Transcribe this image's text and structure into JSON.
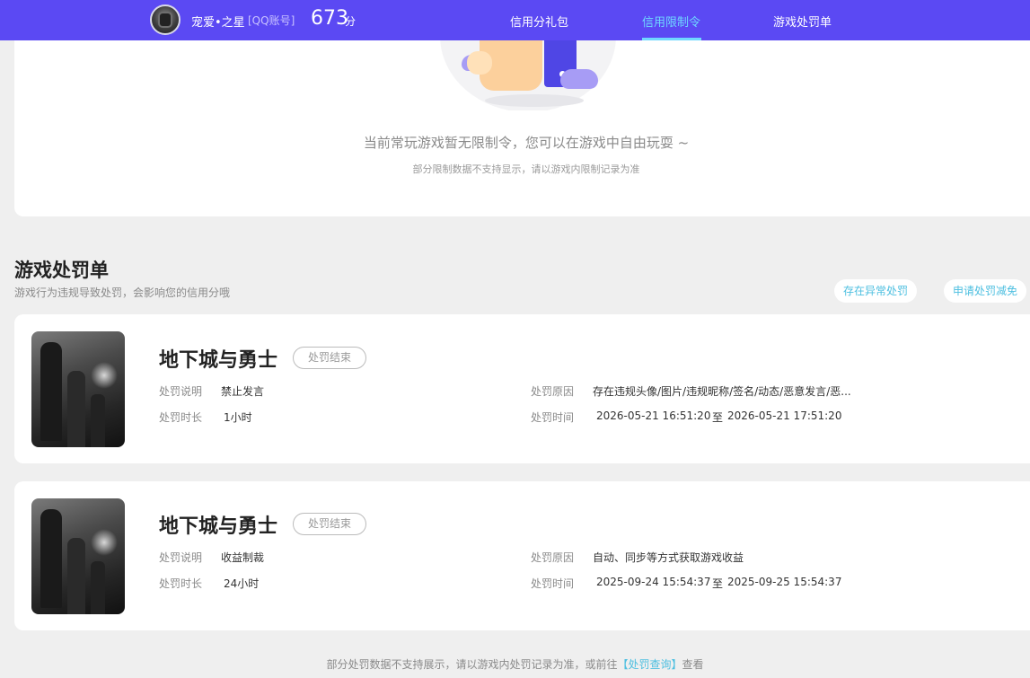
{
  "header": {
    "username": "宠爱•之星",
    "account_type": "[QQ账号]",
    "score": "673",
    "score_unit": "分",
    "tabs": [
      {
        "label": "信用分礼包",
        "active": false
      },
      {
        "label": "信用限制令",
        "active": true
      },
      {
        "label": "游戏处罚单",
        "active": false
      }
    ],
    "colors": {
      "bar": "#5b49f3",
      "active_tab": "#6fd8ff"
    }
  },
  "restriction": {
    "message": "当前常玩游戏暂无限制令，您可以在游戏中自由玩耍 ~",
    "note": "部分限制数据不支持显示，请以游戏内限制记录为准"
  },
  "penalty_section": {
    "title": "游戏处罚单",
    "description": "游戏行为违规导致处罚，会影响您的信用分哦",
    "buttons": [
      "存在异常处罚",
      "申请处罚减免"
    ]
  },
  "penalties": [
    {
      "game": "地下城与勇士",
      "status": "处罚结束",
      "desc_label": "处罚说明",
      "desc": "禁止发言",
      "duration_label": "处罚时长",
      "duration": "1小时",
      "reason_label": "处罚原因",
      "reason": "存在违规头像/图片/违规昵称/签名/动态/恶意发言/恶...",
      "time_label": "处罚时间",
      "start": "2026-05-21 16:51:20",
      "to": "至",
      "end": "2026-05-21 17:51:20"
    },
    {
      "game": "地下城与勇士",
      "status": "处罚结束",
      "desc_label": "处罚说明",
      "desc": "收益制裁",
      "duration_label": "处罚时长",
      "duration": "24小时",
      "reason_label": "处罚原因",
      "reason": "自动、同步等方式获取游戏收益",
      "time_label": "处罚时间",
      "start": "2025-09-24 15:54:37",
      "to": "至",
      "end": "2025-09-25 15:54:37"
    }
  ],
  "footer": {
    "text": "部分处罚数据不支持展示，请以游戏内处罚记录为准，或前往",
    "link": "【处罚查询】",
    "tail": "查看"
  }
}
